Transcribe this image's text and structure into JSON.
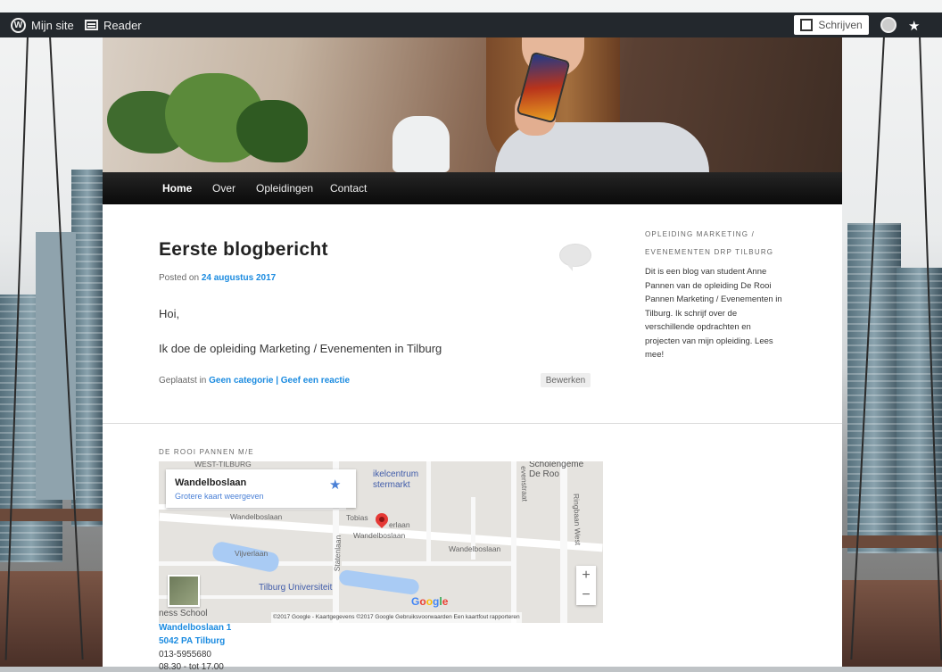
{
  "admin_bar": {
    "my_site": "Mijn site",
    "reader": "Reader",
    "write": "Schrijven"
  },
  "nav": {
    "items": [
      "Home",
      "Over",
      "Opleidingen",
      "Contact"
    ],
    "active": "Home"
  },
  "post": {
    "title": "Eerste blogbericht",
    "posted_on_prefix": "Posted on ",
    "date": "24 augustus 2017",
    "paragraphs": [
      "Hoi,",
      "Ik doe de opleiding Marketing / Evenementen in Tilburg"
    ],
    "categorized_prefix": "Geplaatst in ",
    "category": "Geen categorie",
    "separator": " | ",
    "reply": "Geef een reactie",
    "edit": "Bewerken"
  },
  "sidebar": {
    "title_line1": "OPLEIDING MARKETING /",
    "title_line2": "EVENEMENTEN DRP TILBURG",
    "text": "Dit is een blog van student Anne Pannen van de opleiding De Rooi Pannen Marketing / Evenementen in Tilburg. Ik schrijf over de verschillende opdrachten en projecten van mijn opleiding. Lees mee!"
  },
  "footer_widget": {
    "title": "DE ROOI PANNEN M/E",
    "map": {
      "place": "Wandelboslaan",
      "larger_map": "Grotere kaart weergeven",
      "labels": {
        "winkelcentrum": "ikelcentrum",
        "westermarkt": "stermarkt",
        "school1": "Scholengeme",
        "school2": "De Roo",
        "street_top": "Wandelboslaan",
        "tobias": "Tobias",
        "erlaan": "erlaan",
        "wandelbos_mid": "Wandelboslaan",
        "wandelbos_right": "Wandelboslaan",
        "vijverlaan": "Vijverlaan",
        "statenlaan": "Statenlaan",
        "uni": "Tilburg Universiteit",
        "ringbaan": "Ringbaan West",
        "business_school": "ness School",
        "wjk": "WEST-TILBURG",
        "evenstraat": "evenstraat"
      },
      "google": "Google",
      "attribution": "©2017 Google - Kaartgegevens ©2017 Google    Gebruiksvoorwaarden    Een kaartfout rapporteren",
      "zoom_in": "+",
      "zoom_out": "−"
    },
    "address_line1": "Wandelboslaan 1",
    "address_line2": "5042 PA Tilburg",
    "phone": "013-5955680",
    "hours": "08.30 - tot 17.00"
  },
  "colors": {
    "admin_bar": "#23282d",
    "link": "#1b8be0",
    "nav_bg": "#111111"
  }
}
